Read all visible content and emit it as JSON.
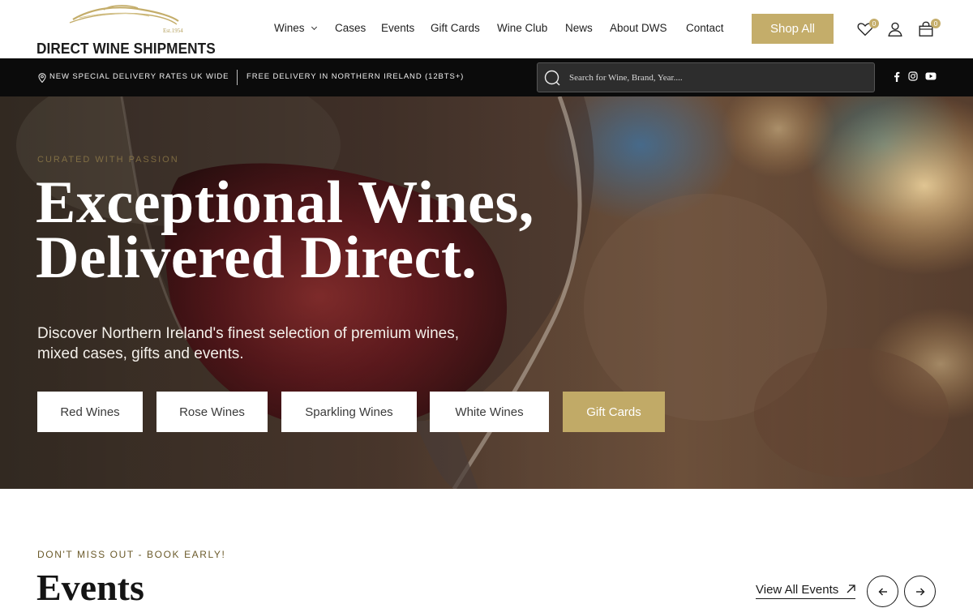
{
  "brand": {
    "name": "DIRECT WINE SHIPMENTS",
    "est": "Est.1954"
  },
  "nav": {
    "items": [
      {
        "label": "Wines",
        "has_dropdown": true
      },
      {
        "label": "Cases"
      },
      {
        "label": "Events"
      },
      {
        "label": "Gift Cards"
      },
      {
        "label": "Wine Club"
      },
      {
        "label": "News"
      },
      {
        "label": "About DWS"
      },
      {
        "label": "Contact"
      }
    ],
    "cta_label": "Shop All"
  },
  "header_icons": {
    "wishlist": {
      "icon": "heart-icon",
      "count": "0"
    },
    "account": {
      "icon": "user-icon"
    },
    "cart": {
      "icon": "shopping-bag-icon",
      "count": "0"
    }
  },
  "utility_bar": {
    "promo_1": "NEW SPECIAL DELIVERY RATES UK WIDE",
    "promo_2": "FREE DELIVERY IN NORTHERN IRELAND (12BTS+)",
    "search_placeholder": "Search for Wine, Brand, Year....",
    "social": [
      "facebook-icon",
      "instagram-icon",
      "youtube-icon"
    ]
  },
  "hero": {
    "eyebrow": "CURATED WITH PASSION",
    "title_line_1": "Exceptional Wines,",
    "title_line_2": "Delivered Direct.",
    "subtitle": "Discover Northern Ireland's finest selection of premium wines, mixed cases, gifts and events.",
    "buttons": [
      {
        "label": "Red Wines"
      },
      {
        "label": "Rose Wines"
      },
      {
        "label": "Sparkling Wines"
      },
      {
        "label": "White Wines"
      },
      {
        "label": "Gift Cards"
      }
    ]
  },
  "events": {
    "eyebrow": "DON'T MISS OUT - BOOK EARLY!",
    "title": "Events",
    "view_all": "View All Events"
  },
  "colors": {
    "accent_gold": "#c4ad6a",
    "utility_bar_bg": "#0b0b0b",
    "text_dark": "#1a1a1a"
  }
}
